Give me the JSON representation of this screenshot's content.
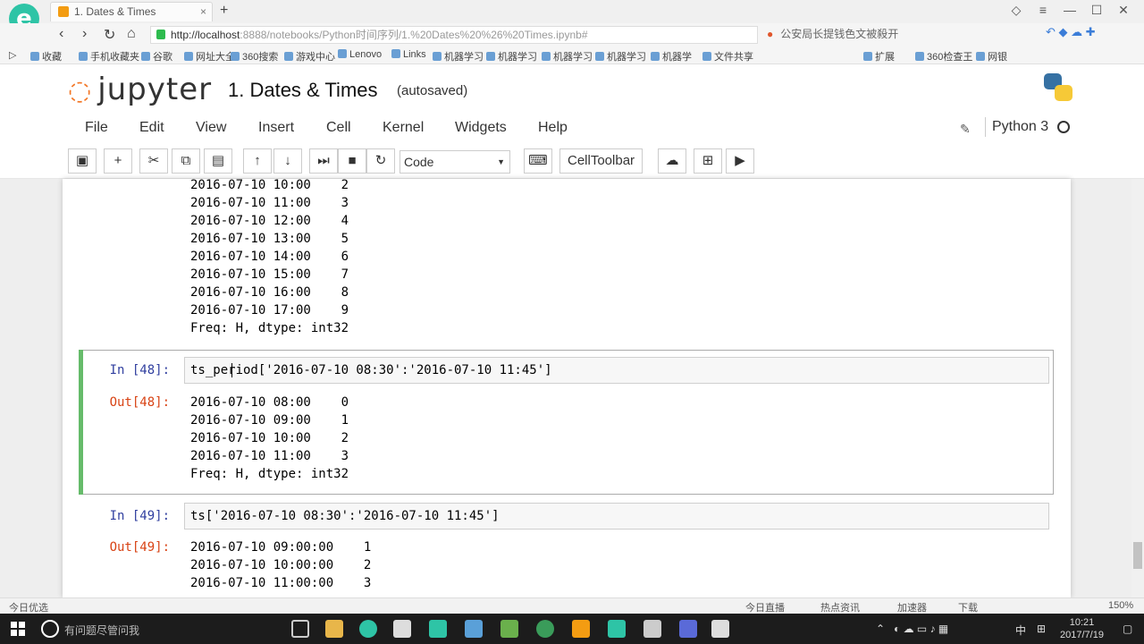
{
  "browser": {
    "tab_title": "1. Dates & Times",
    "tab_close": "×",
    "new_tab": "+",
    "url_host": "http://localhost",
    "url_rest": ":8888/notebooks/Python时间序列/1.%20Dates%20%26%20Times.ipynb#",
    "search_text": "公安局长提钱色文被殺开",
    "bookmarks": [
      "收藏",
      "手机收藏夹",
      "谷歌",
      "网址大全",
      "360搜索",
      "游戏中心",
      "Lenovo",
      "Links",
      "机器学习",
      "机器学习",
      "机器学习",
      "机器学习",
      "机器学",
      "文件共享",
      "扩展",
      "360检查王",
      "网银"
    ]
  },
  "jupyter": {
    "logo_text": "jupyter",
    "notebook_title": "1. Dates & Times",
    "autosaved": "(autosaved)",
    "menu": [
      "File",
      "Edit",
      "View",
      "Insert",
      "Cell",
      "Kernel",
      "Widgets",
      "Help"
    ],
    "kernel_name": "Python 3",
    "cell_type": "Code",
    "celltoolbar_label": "CellToolbar"
  },
  "notebook": {
    "prev_output": [
      "2016-07-10 10:00    2",
      "2016-07-10 11:00    3",
      "2016-07-10 12:00    4",
      "2016-07-10 13:00    5",
      "2016-07-10 14:00    6",
      "2016-07-10 15:00    7",
      "2016-07-10 16:00    8",
      "2016-07-10 17:00    9",
      "Freq: H, dtype: int32"
    ],
    "cell48": {
      "in_prompt": "In [48]:",
      "code": "ts_period['2016-07-10 08:30':'2016-07-10 11:45']",
      "out_prompt": "Out[48]:",
      "output": [
        "2016-07-10 08:00    0",
        "2016-07-10 09:00    1",
        "2016-07-10 10:00    2",
        "2016-07-10 11:00    3",
        "Freq: H, dtype: int32"
      ]
    },
    "cell49": {
      "in_prompt": "In [49]:",
      "code": "ts['2016-07-10 08:30':'2016-07-10 11:45']",
      "out_prompt": "Out[49]:",
      "output": [
        "2016-07-10 09:00:00    1",
        "2016-07-10 10:00:00    2",
        "2016-07-10 11:00:00    3"
      ]
    }
  },
  "statusbar": {
    "left": "今日优选",
    "items": [
      "今日直播",
      "热点资讯",
      "加速器",
      "下载",
      "150%"
    ]
  },
  "taskbar": {
    "search_placeholder": "有问题尽管问我",
    "ime": "中",
    "time": "10:21",
    "date": "2017/7/19"
  },
  "colors": {
    "in_prompt": "#303f9f",
    "out_prompt": "#d84315",
    "selected_cell_bar": "#66bb6a",
    "jupyter_orange": "#f37726"
  }
}
